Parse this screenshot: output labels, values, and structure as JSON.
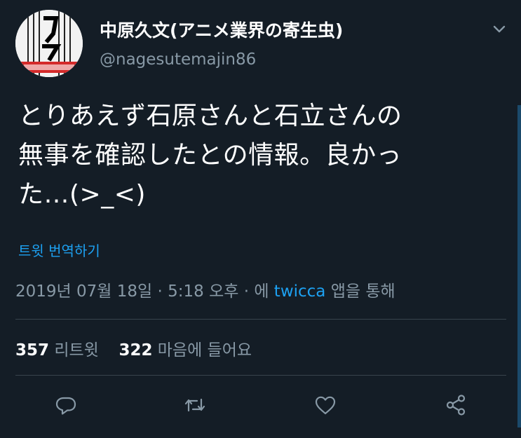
{
  "user": {
    "display_name": "中原久文(アニメ業界の寄生虫)",
    "handle": "@nagesutemajin86"
  },
  "tweet": {
    "text_line1": "とりあえず石原さんと石立さんの",
    "text_line2": "無事を確認したとの情報。良かっ",
    "text_line3": "た…(>_<)",
    "translate_label": "트윗 번역하기"
  },
  "meta": {
    "date": "2019년 07월 18일",
    "sep1": " · ",
    "time": "5:18 오후",
    "sep2": " · 에 ",
    "source": "twicca",
    "via": " 앱을 통해"
  },
  "stats": {
    "retweets_count": "357",
    "retweets_label": "리트윗",
    "likes_count": "322",
    "likes_label": "마음에 들어요"
  },
  "icons": {
    "reply": "reply-icon",
    "retweet": "retweet-icon",
    "like": "heart-icon",
    "share": "share-icon",
    "menu": "chevron-down-icon"
  },
  "colors": {
    "background": "#141d26",
    "accent": "#1da1f2",
    "secondary_text": "#8899a6"
  }
}
